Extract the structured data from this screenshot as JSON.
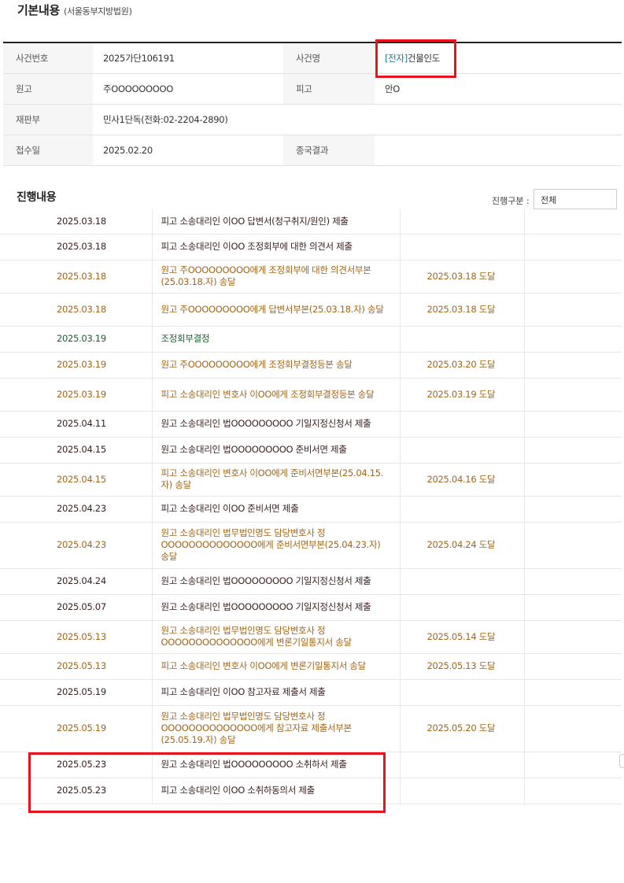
{
  "header": {
    "title": "기본내용",
    "court": "(서울동부지방법원)"
  },
  "info": {
    "case_no_label": "사건번호",
    "case_no": "2025가단106191",
    "case_name_label": "사건명",
    "case_name_tag": "[전자]",
    "case_name": "건물인도",
    "plaintiff_label": "원고",
    "plaintiff": "주OOOOOOOOO",
    "defendant_label": "피고",
    "defendant": "안O",
    "division_label": "재판부",
    "division": "민사1단독(전화:02-2204-2890)",
    "filed_label": "접수일",
    "filed": "2025.02.20",
    "result_label": "종국결과",
    "result": ""
  },
  "progress": {
    "title": "진행내용",
    "filter_label": "진행구분 :",
    "filter_value": "전체",
    "rows": [
      {
        "date": "2025.03.18",
        "content": "피고 소송대리인 이OO 답변서(청구취지/원인) 제출",
        "result": "",
        "kind": "sub"
      },
      {
        "date": "2025.03.18",
        "content": "피고 소송대리인 이OO 조정회부에 대한 의견서 제출",
        "result": "",
        "kind": "sub"
      },
      {
        "date": "2025.03.18",
        "content": "원고 주OOOOOOOOO에게 조정회부에 대한 의견서부본(25.03.18.자) 송달",
        "result": "2025.03.18 도달",
        "kind": "send"
      },
      {
        "date": "2025.03.18",
        "content": "원고 주OOOOOOOOO에게 답변서부본(25.03.18.자) 송달",
        "result": "2025.03.18 도달",
        "kind": "send"
      },
      {
        "date": "2025.03.19",
        "content": "조정회부결정",
        "result": "",
        "kind": "dec"
      },
      {
        "date": "2025.03.19",
        "content": "원고 주OOOOOOOOO에게 조정회부결정등본 송달",
        "result": "2025.03.20 도달",
        "kind": "send"
      },
      {
        "date": "2025.03.19",
        "content": "피고 소송대리인 변호사 이OO에게 조정회부결정등본 송달",
        "result": "2025.03.19 도달",
        "kind": "send"
      },
      {
        "date": "2025.04.11",
        "content": "원고 소송대리인 법OOOOOOOOO 기일지정신청서 제출",
        "result": "",
        "kind": "sub"
      },
      {
        "date": "2025.04.15",
        "content": "원고 소송대리인 법OOOOOOOOO 준비서면 제출",
        "result": "",
        "kind": "sub"
      },
      {
        "date": "2025.04.15",
        "content": "피고 소송대리인 변호사 이OO에게 준비서면부본(25.04.15.자) 송달",
        "result": "2025.04.16 도달",
        "kind": "send"
      },
      {
        "date": "2025.04.23",
        "content": "피고 소송대리인 이OO 준비서면 제출",
        "result": "",
        "kind": "sub"
      },
      {
        "date": "2025.04.23",
        "content": "원고 소송대리인 법무법인명도 담당변호사 정OOOOOOOOOOOOOO에게 준비서면부본(25.04.23.자) 송달",
        "result": "2025.04.24 도달",
        "kind": "send"
      },
      {
        "date": "2025.04.24",
        "content": "원고 소송대리인 법OOOOOOOOO 기일지정신청서 제출",
        "result": "",
        "kind": "sub"
      },
      {
        "date": "2025.05.07",
        "content": "원고 소송대리인 법OOOOOOOOO 기일지정신청서 제출",
        "result": "",
        "kind": "sub"
      },
      {
        "date": "2025.05.13",
        "content": "원고 소송대리인 법무법인명도 담당변호사 정OOOOOOOOOOOOOO에게 변론기일통지서 송달",
        "result": "2025.05.14 도달",
        "kind": "send"
      },
      {
        "date": "2025.05.13",
        "content": "피고 소송대리인 변호사 이OO에게 변론기일통지서 송달",
        "result": "2025.05.13 도달",
        "kind": "send"
      },
      {
        "date": "2025.05.19",
        "content": "피고 소송대리인 이OO 참고자료 제출서 제출",
        "result": "",
        "kind": "sub"
      },
      {
        "date": "2025.05.19",
        "content": "원고 소송대리인 법무법인명도 담당변호사 정OOOOOOOOOOOOOO에게 참고자료 제출서부본(25.05.19.자) 송달",
        "result": "2025.05.20 도달",
        "kind": "send"
      },
      {
        "date": "2025.05.23",
        "content": "원고 소송대리인 법OOOOOOOOO 소취하서 제출",
        "result": "",
        "kind": "sub"
      },
      {
        "date": "2025.05.23",
        "content": "피고 소송대리인 이OO 소취하동의서 제출",
        "result": "",
        "kind": "sub"
      }
    ]
  },
  "colors": {
    "highlight": "#e8141d",
    "submitted": "#3a1f1f",
    "served": "#a26519",
    "decision": "#1e5f30",
    "tag": "#1f7a8a"
  }
}
